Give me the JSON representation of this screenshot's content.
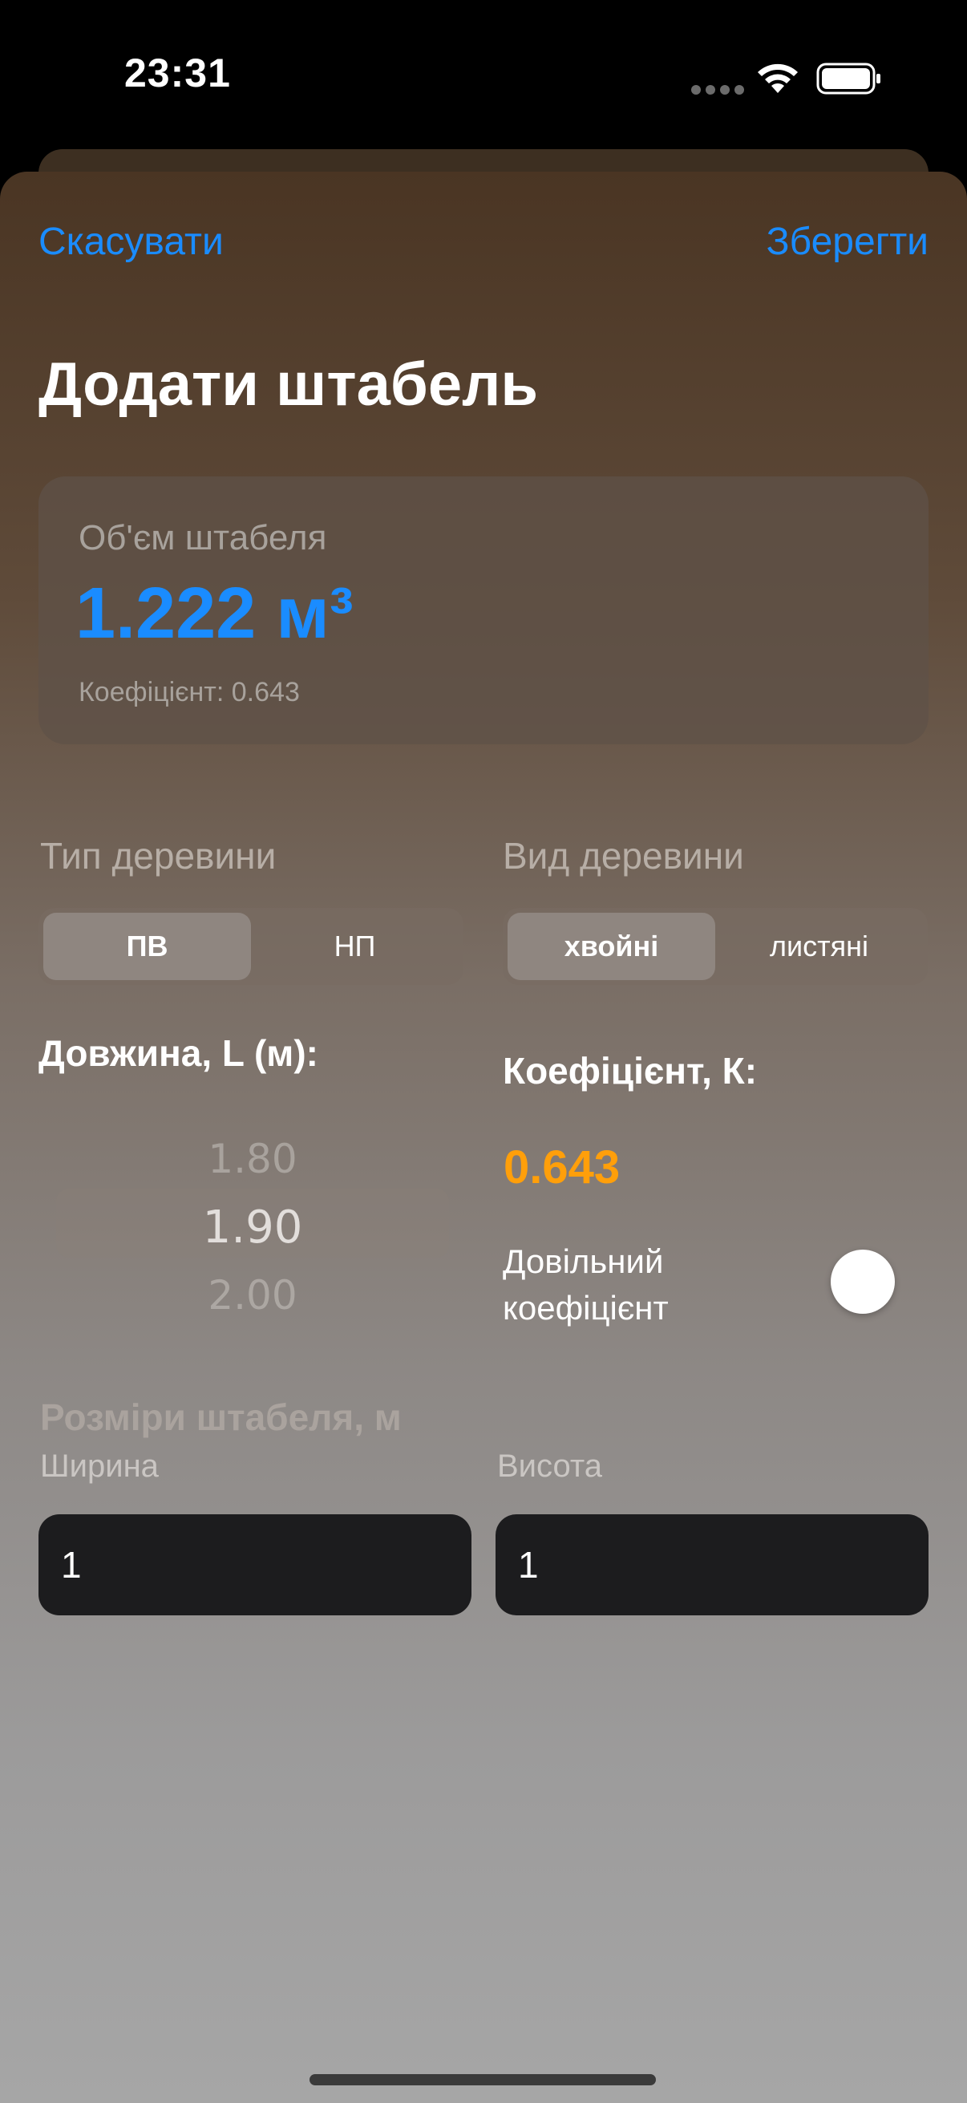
{
  "status_bar": {
    "time": "23:31",
    "icons": [
      "signal-dots-icon",
      "wifi-icon",
      "battery-icon"
    ]
  },
  "nav": {
    "cancel_label": "Скасувати",
    "save_label": "Зберегти"
  },
  "title": "Додати штабель",
  "volume": {
    "label": "Об'єм штабеля",
    "value": "1.222 м³",
    "coefficient_text": "Коефіцієнт: 0.643"
  },
  "wood_type": {
    "label": "Тип деревини",
    "options": [
      "ПВ",
      "НП"
    ],
    "selected": "ПВ"
  },
  "wood_kind": {
    "label": "Вид деревини",
    "options": [
      "хвойні",
      "листяні"
    ],
    "selected": "хвойні"
  },
  "length": {
    "label": "Довжина, L (м):",
    "picker": {
      "prev": "1.80",
      "current": "1.90",
      "next": "2.00"
    }
  },
  "coefficient": {
    "label": "Коефіцієнт, К:",
    "value": "0.643",
    "custom_toggle_label": "Довільний коефіцієнт",
    "custom_toggle_on": false
  },
  "dimensions": {
    "label": "Розміри штабеля, м",
    "width_label": "Ширина",
    "width_value": "1",
    "height_label": "Висота",
    "height_value": "1"
  },
  "colors": {
    "accent": "#1a8cff",
    "coefficient": "#ff9f0a",
    "input_bg": "#1c1c1e"
  }
}
